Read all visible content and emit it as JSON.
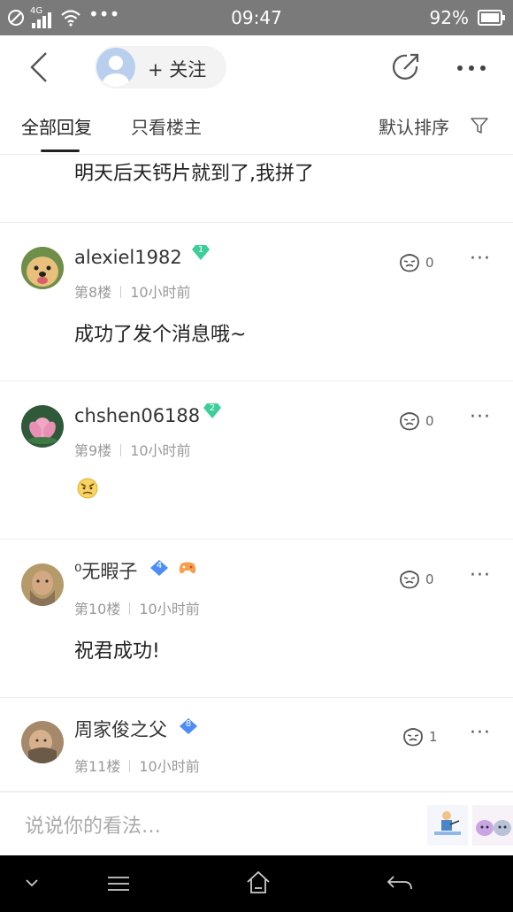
{
  "status_bar": {
    "network": "4G",
    "time": "09:47",
    "battery": "92%"
  },
  "header": {
    "follow_label": "+ 关注"
  },
  "tabs": {
    "all_replies": "全部回复",
    "owner_only": "只看楼主",
    "sort": "默认排序"
  },
  "partial_comment": {
    "text": "明天后天钙片就到了,我拼了"
  },
  "comments": [
    {
      "username": "alexiel1982",
      "badge": "1",
      "badge_color": "#3ccf9a",
      "floor": "第8楼",
      "time": "10小时前",
      "text": "成功了发个消息哦~",
      "likes": "0"
    },
    {
      "username": "chshen06188",
      "badge": "2",
      "badge_color": "#3ccf9a",
      "floor": "第9楼",
      "time": "10小时前",
      "text": "",
      "likes": "0"
    },
    {
      "username": "⁰无暇子",
      "badge": "4",
      "badge_color": "#4d8df5",
      "floor": "第10楼",
      "time": "10小时前",
      "text": "祝君成功!",
      "likes": "0"
    },
    {
      "username": "周家俊之父",
      "badge": "8",
      "badge_color": "#4d8df5",
      "floor": "第11楼",
      "time": "10小时前",
      "text": "",
      "likes": "1"
    }
  ],
  "input": {
    "placeholder": "说说你的看法…"
  },
  "icons": {
    "back": "back-icon",
    "share": "share-icon",
    "more": "more-icon",
    "filter": "filter-icon",
    "like": "like-icon",
    "emoji": "angry-emoji-icon"
  },
  "colors": {
    "status_bar": "#7a7a7a",
    "nav_bar": "#000000",
    "level_green": "#3ccf9a",
    "level_blue": "#4d8df5"
  }
}
